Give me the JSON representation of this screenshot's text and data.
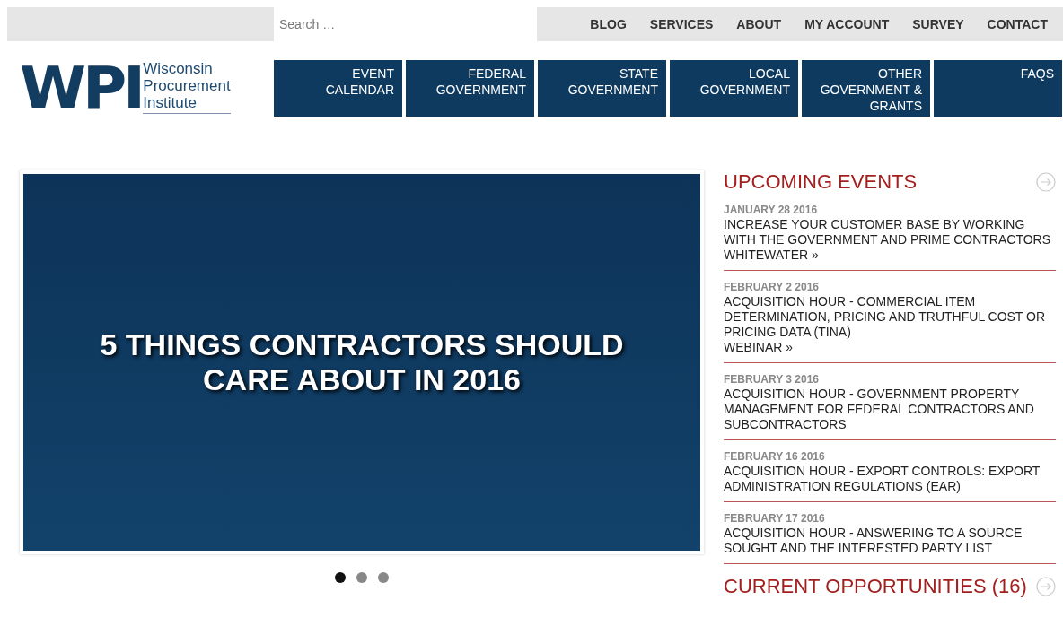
{
  "search": {
    "placeholder": "Search …"
  },
  "top_nav": [
    "BLOG",
    "SERVICES",
    "ABOUT",
    "MY ACCOUNT",
    "SURVEY",
    "CONTACT"
  ],
  "logo": {
    "mark": "WPI",
    "lines": [
      "Wisconsin",
      "Procurement",
      "Institute"
    ]
  },
  "main_nav": [
    {
      "label": "EVENT CALENDAR"
    },
    {
      "label": "FEDERAL GOVERNMENT"
    },
    {
      "label": "STATE GOVERNMENT"
    },
    {
      "label": "LOCAL GOVERNMENT"
    },
    {
      "label": "OTHER GOVERNMENT & GRANTS"
    },
    {
      "label": "FAQS"
    }
  ],
  "slider": {
    "headline": "5 THINGS CONTRACTORS SHOULD CARE ABOUT IN 2016",
    "dots": [
      {
        "selected": true
      },
      {
        "selected": false
      },
      {
        "selected": false
      }
    ]
  },
  "upcoming_events": {
    "heading": "UPCOMING EVENTS",
    "events": [
      {
        "date": "JANUARY 28 2016",
        "title": "INCREASE YOUR CUSTOMER BASE BY WORKING WITH THE GOVERNMENT AND PRIME CONTRACTORS",
        "location": "WHITEWATER »"
      },
      {
        "date": "FEBRUARY 2 2016",
        "title": "ACQUISITION HOUR - COMMERCIAL ITEM DETERMINATION, PRICING AND TRUTHFUL COST OR PRICING DATA (TINA)",
        "location": "WEBINAR »"
      },
      {
        "date": "FEBRUARY 3 2016",
        "title": "ACQUISITION HOUR - GOVERNMENT PROPERTY MANAGEMENT FOR FEDERAL CONTRACTORS AND SUBCONTRACTORS"
      },
      {
        "date": "FEBRUARY 16 2016",
        "title": "ACQUISITION HOUR - EXPORT CONTROLS: EXPORT ADMINISTRATION REGULATIONS (EAR)"
      },
      {
        "date": "FEBRUARY 17 2016",
        "title": "ACQUISITION HOUR - ANSWERING TO A SOURCE SOUGHT AND THE INTERESTED PARTY LIST"
      }
    ]
  },
  "current_opportunities": {
    "heading": "CURRENT OPPORTUNITIES (16)"
  }
}
